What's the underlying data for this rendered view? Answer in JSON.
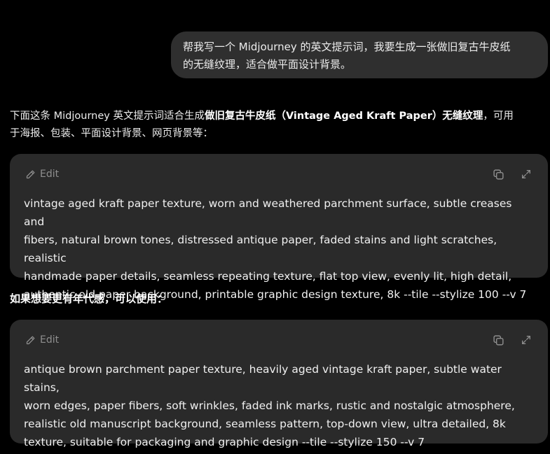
{
  "user_message": {
    "line1": "帮我写一个 Midjourney 的英文提示词，我要生成一张做旧复古牛皮纸",
    "line2": "的无缝纹理，适合做平面设计背景。"
  },
  "reply": {
    "intro_before": "下面这条 Midjourney 英文提示词适合生成",
    "intro_bold": "做旧复古牛皮纸（Vintage Aged Kraft Paper）无缝纹理",
    "intro_after": "，可用",
    "intro_line2": "于海报、包装、平面设计背景、网页背景等：",
    "section_heading": "如果想要更有年代感，可以使用："
  },
  "code_blocks": [
    {
      "edit_label": "Edit",
      "text": "vintage aged kraft paper texture, worn and weathered parchment surface, subtle creases and\nfibers, natural brown tones, distressed antique paper, faded stains and light scratches, realistic\nhandmade paper details, seamless repeating texture, flat top view, evenly lit, high detail,\nauthentic old paper background, printable graphic design texture, 8k --tile --stylize 100 --v 7"
    },
    {
      "edit_label": "Edit",
      "text": "antique brown parchment paper texture, heavily aged vintage kraft paper, subtle water stains,\nworn edges, paper fibers, soft wrinkles, faded ink marks, rustic and nostalgic atmosphere,\nrealistic old manuscript background, seamless pattern, top-down view, ultra detailed, 8k\ntexture, suitable for packaging and graphic design --tile --stylize 150 --v 7"
    }
  ],
  "icons": {
    "edit": "pencil-icon",
    "copy": "copy-icon",
    "expand": "expand-icon"
  },
  "colors": {
    "background": "#000000",
    "user_bubble": "#2f2f2f",
    "code_card": "#2a2a2a",
    "muted_icon": "#8e8e8e"
  }
}
